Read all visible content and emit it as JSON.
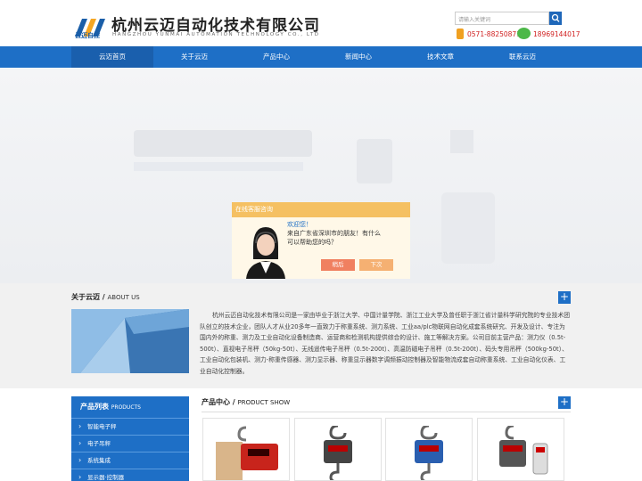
{
  "header": {
    "logo_text": "云迈自控",
    "company_name": "杭州云迈自动化技术有限公司",
    "company_name_en": "HANGZHOU YUNMAI AUTOMATION TECHNOLOGY CO., LTD",
    "search_placeholder": "请输入关键词",
    "phone1": "0571-88250871",
    "phone2": "18969144017"
  },
  "nav": {
    "items": [
      "云迈首页",
      "关于云迈",
      "产品中心",
      "新闻中心",
      "技术文章",
      "联系云迈"
    ]
  },
  "chat": {
    "title": "在线客服咨询",
    "line1": "欢迎您！",
    "line2": "来自广东省深圳市的朋友！有什么",
    "line3": "可以帮助您的吗？",
    "btn_close": "稍后",
    "btn_next": "下次"
  },
  "about": {
    "title_cn": "关于云迈",
    "title_sep": " / ",
    "title_en": "ABOUT US",
    "text": "杭州云迈自动化技术有限公司是一家由毕业于浙江大学、中国计量学院、浙江工业大学及曾任职于浙江省计量科学研究院的专业技术团队创立的技术企业，团队人才从业20多年一直致力于称重系统、测力系统、工业aa/plc物联网自动化成套系统研究、开发及设计、专注为国内外的称重、测力及工业自动化设备制造商、运营商和检测机构提供综合的设计、施工等解决方案。公司目前主营产品：测力仪（0.5t-500t）、直视电子吊秤（50kg-50t）、无线遥传电子吊秤（0.5t-200t）、高温防磁电子吊秤（0.5t-200t）、码头专用吊秤（500kg-50t）、工业自动化包装机、测力-称重传感器、测力显示器、称重显示器数字调频振动控制器及智能物流成套自动称重系统、工业自动化仪表、工业自动化控制器。"
  },
  "products_sidebar": {
    "title_cn": "产品列表",
    "title_en": "PRODUCTS",
    "items": [
      "智能电子秤",
      "电子吊秤",
      "系统集成",
      "显示器·控制器"
    ]
  },
  "product_show": {
    "title_cn": "产品中心",
    "title_sep": " / ",
    "title_en": "PRODUCT SHOW"
  },
  "colors": {
    "brand_blue": "#1e6fc6",
    "nav_active": "#1a5fad",
    "phone_red": "#d02020",
    "chat_orange": "#f5c062"
  }
}
